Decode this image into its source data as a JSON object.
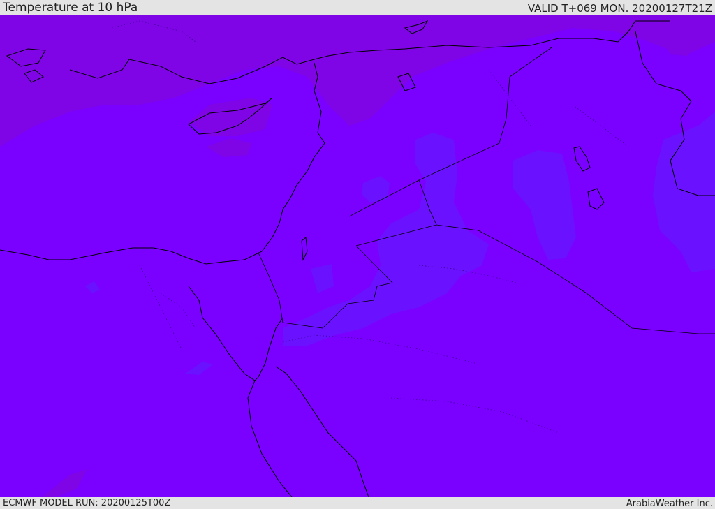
{
  "header": {
    "title": "Temperature at 10 hPa",
    "valid": "VALID T+069 MON. 20200127T21Z"
  },
  "footer": {
    "model_run": "ECMWF MODEL RUN: 20200125T00Z",
    "credit": "ArabiaWeather Inc."
  },
  "colors": {
    "background_field": "#7a00ff",
    "warmer_field": "#7f05e6",
    "cooler_field": "#6a12ff",
    "coastline": "#000000"
  }
}
